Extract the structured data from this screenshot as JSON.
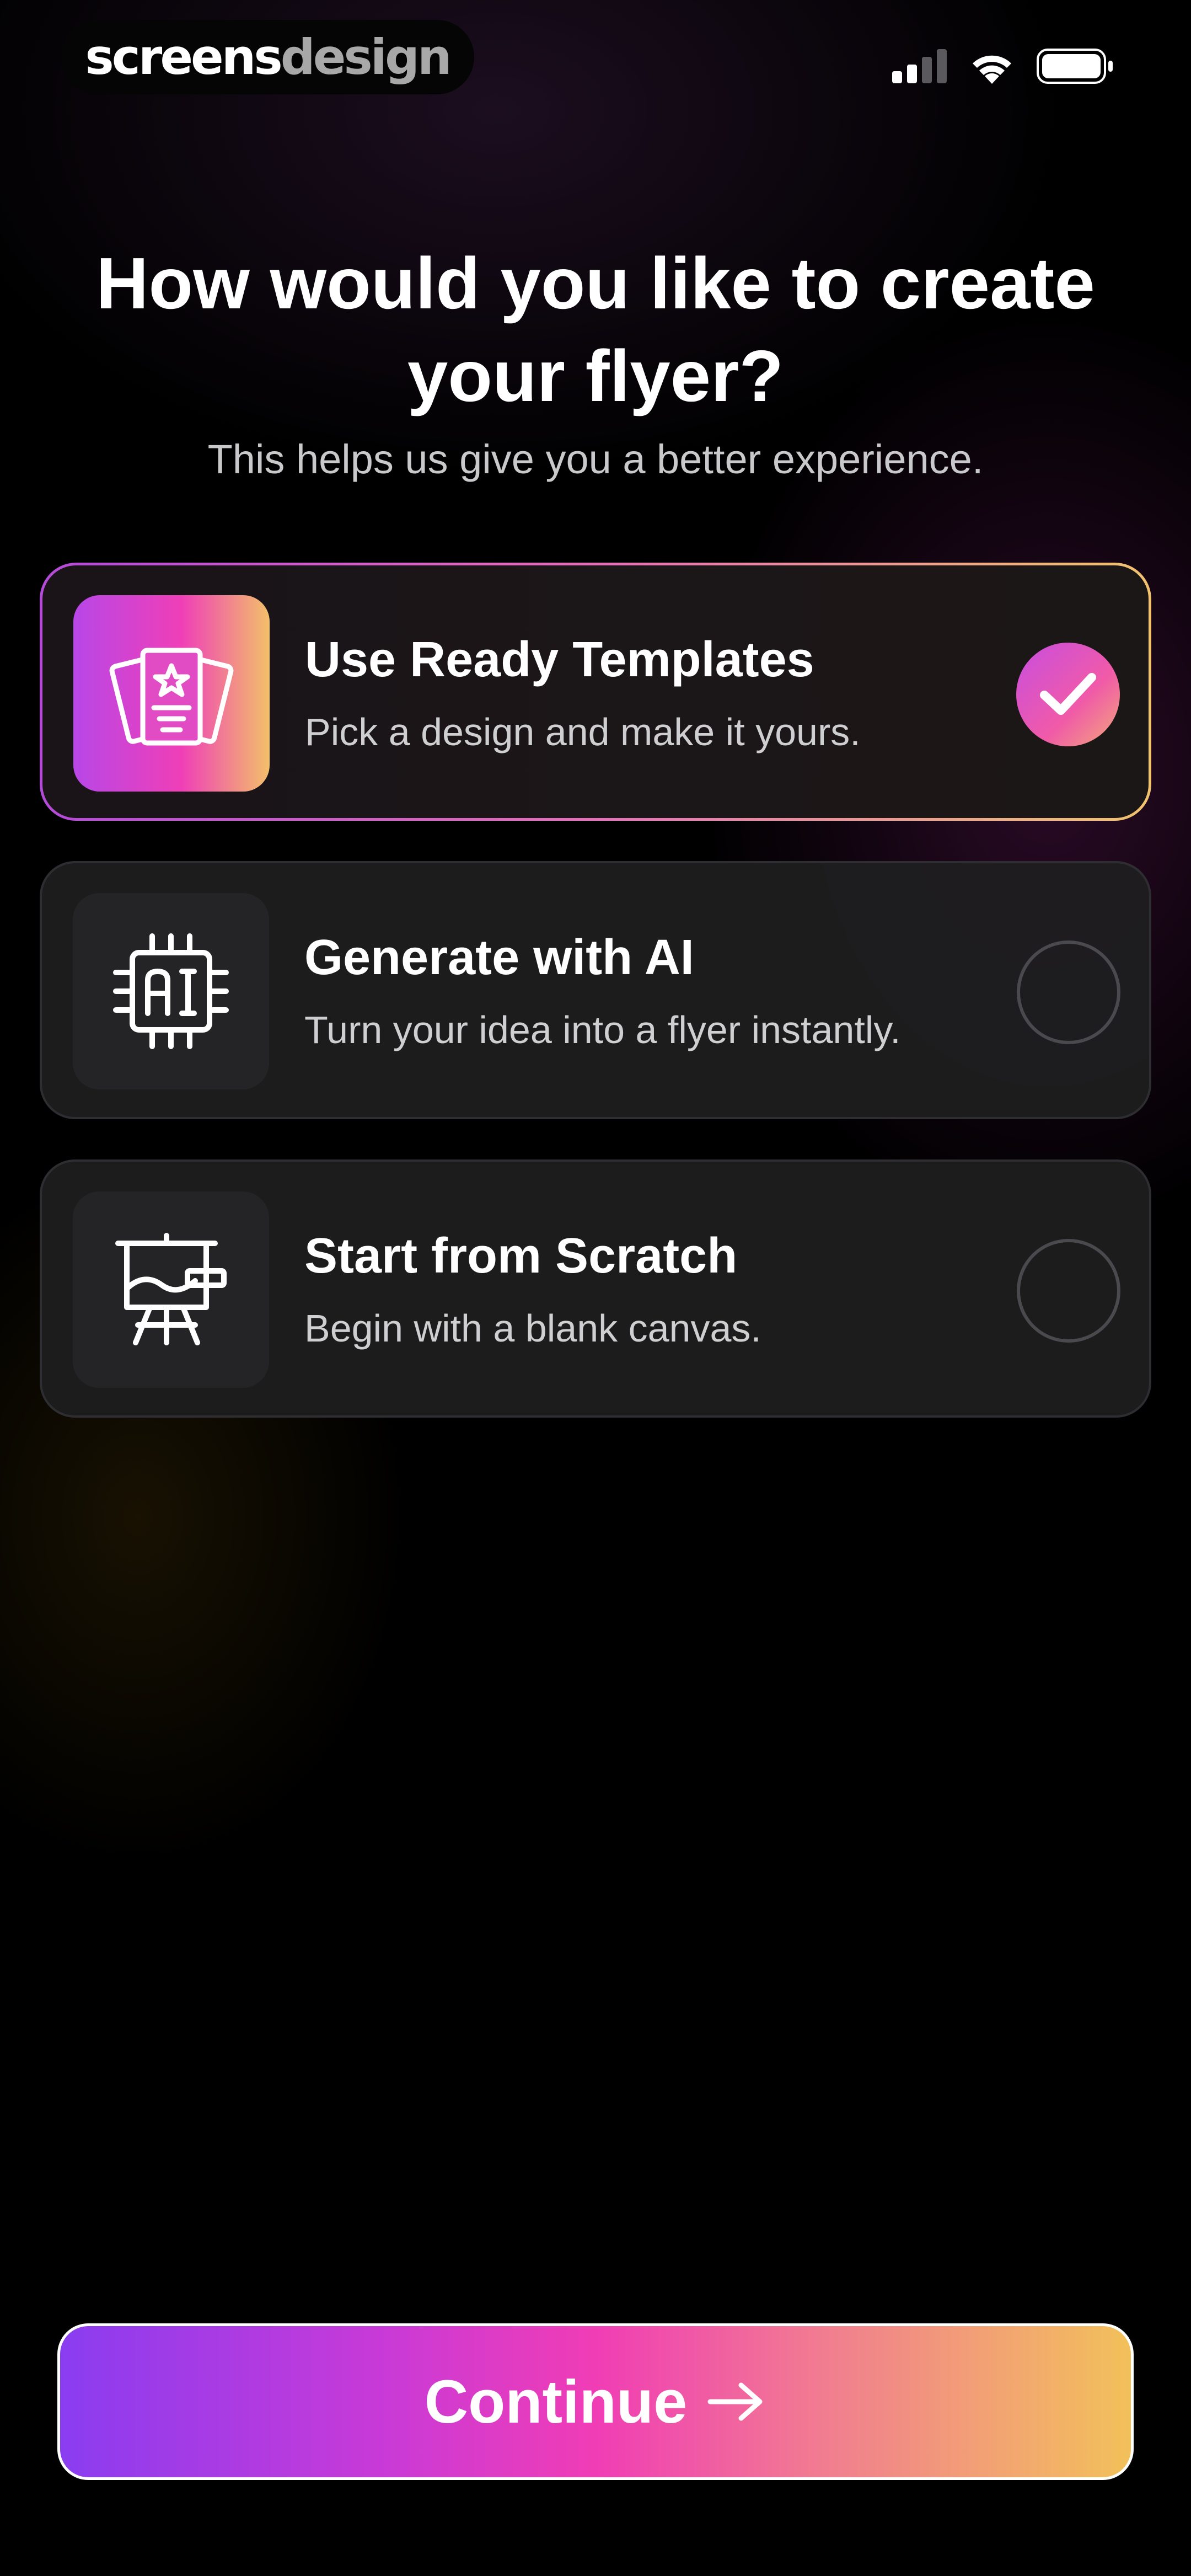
{
  "status_bar": {
    "logo_primary": "screens",
    "logo_secondary": "design",
    "icons": [
      "cellular-signal-icon",
      "wifi-icon",
      "battery-icon"
    ]
  },
  "header": {
    "title": "How would you like to create your flyer?",
    "subtitle": "This helps us give you a better experience."
  },
  "options": [
    {
      "title": "Use Ready Templates",
      "description": "Pick a design and make it yours.",
      "icon": "templates-icon",
      "selected": true
    },
    {
      "title": "Generate with AI",
      "description": "Turn your idea into a flyer instantly.",
      "icon": "ai-chip-icon",
      "selected": false
    },
    {
      "title": "Start from Scratch",
      "description": "Begin with a blank canvas.",
      "icon": "easel-canvas-icon",
      "selected": false
    }
  ],
  "continue_button": {
    "label": "Continue",
    "icon": "arrow-right-icon"
  },
  "colors": {
    "background": "#000000",
    "card": "#1e1e20",
    "accent_start": "#8a3df0",
    "accent_mid": "#f03db5",
    "accent_end": "#f2c15a"
  }
}
